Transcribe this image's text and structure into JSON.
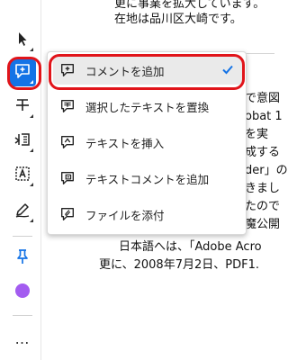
{
  "document": {
    "lines": [
      "更に事業を拡大しています。",
      "在地は品川区大崎です。",
      "で意図",
      "obat 1",
      "を実",
      "成する",
      "der」の",
      "きまし",
      "たので",
      "魔公開",
      "日本語へは、「Adobe Acro",
      "更に、2008年7月2日、PDF1."
    ]
  },
  "toolbar": {
    "tools": [
      {
        "icon": "select-arrow-icon"
      },
      {
        "icon": "add-comment-icon"
      },
      {
        "icon": "text-strike-icon"
      },
      {
        "icon": "insert-text-icon"
      },
      {
        "icon": "text-box-icon"
      },
      {
        "icon": "draw-pen-icon"
      },
      {
        "icon": "pin-icon"
      },
      {
        "icon": "color-swatch"
      },
      {
        "icon": "more-icon"
      }
    ],
    "active_tool": "add-comment-icon",
    "swatch_color": "#a35cf0",
    "more_label": "…"
  },
  "menu": {
    "items": [
      {
        "label": "コメントを追加",
        "icon": "add-comment-icon",
        "selected": true
      },
      {
        "label": "選択したテキストを置換",
        "icon": "replace-text-icon",
        "selected": false
      },
      {
        "label": "テキストを挿入",
        "icon": "insert-text-icon",
        "selected": false
      },
      {
        "label": "テキストコメントを追加",
        "icon": "text-comment-icon",
        "selected": false
      },
      {
        "label": "ファイルを添付",
        "icon": "attach-file-icon",
        "selected": false
      }
    ]
  },
  "colors": {
    "accent": "#1473e6",
    "highlight_ring": "#e1141a",
    "check": "#1473e6"
  }
}
